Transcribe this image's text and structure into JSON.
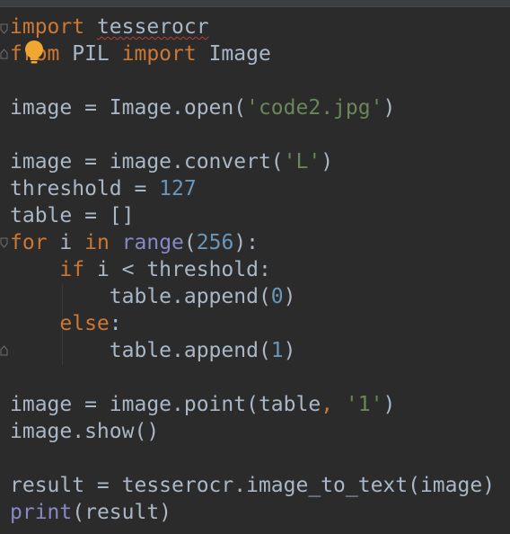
{
  "editor": {
    "lines": [
      [
        {
          "t": "import",
          "c": "kw"
        },
        {
          "t": " ",
          "c": "id"
        },
        {
          "t": "tesserocr",
          "c": "id typo"
        }
      ],
      [
        {
          "t": "from",
          "c": "kw"
        },
        {
          "t": " PIL ",
          "c": "id"
        },
        {
          "t": "import",
          "c": "kw"
        },
        {
          "t": " Image",
          "c": "id"
        }
      ],
      [],
      [
        {
          "t": "image = Image.open(",
          "c": "id"
        },
        {
          "t": "'code2.jpg'",
          "c": "str"
        },
        {
          "t": ")",
          "c": "id"
        }
      ],
      [],
      [
        {
          "t": "image = image.convert(",
          "c": "id"
        },
        {
          "t": "'L'",
          "c": "str"
        },
        {
          "t": ")",
          "c": "id"
        }
      ],
      [
        {
          "t": "threshold = ",
          "c": "id"
        },
        {
          "t": "127",
          "c": "num"
        }
      ],
      [
        {
          "t": "table = []",
          "c": "id"
        }
      ],
      [
        {
          "t": "for",
          "c": "kw"
        },
        {
          "t": " i ",
          "c": "id"
        },
        {
          "t": "in",
          "c": "kw"
        },
        {
          "t": " ",
          "c": "id"
        },
        {
          "t": "range",
          "c": "builtin"
        },
        {
          "t": "(",
          "c": "id"
        },
        {
          "t": "256",
          "c": "num"
        },
        {
          "t": "):",
          "c": "id"
        }
      ],
      [
        {
          "t": "    ",
          "c": "id"
        },
        {
          "t": "if",
          "c": "kw"
        },
        {
          "t": " i < threshold:",
          "c": "id"
        }
      ],
      [
        {
          "t": "        table.append(",
          "c": "id"
        },
        {
          "t": "0",
          "c": "num"
        },
        {
          "t": ")",
          "c": "id"
        }
      ],
      [
        {
          "t": "    ",
          "c": "id"
        },
        {
          "t": "else",
          "c": "kw"
        },
        {
          "t": ":",
          "c": "id"
        }
      ],
      [
        {
          "t": "        table.append(",
          "c": "id"
        },
        {
          "t": "1",
          "c": "num"
        },
        {
          "t": ")",
          "c": "id"
        }
      ],
      [],
      [
        {
          "t": "image = image.point(table",
          "c": "id"
        },
        {
          "t": ",",
          "c": "kw"
        },
        {
          "t": " ",
          "c": "id"
        },
        {
          "t": "'1'",
          "c": "str"
        },
        {
          "t": ")",
          "c": "id"
        }
      ],
      [
        {
          "t": "image.show()",
          "c": "id"
        }
      ],
      [],
      [
        {
          "t": "result = tesserocr.image_to_text(image)",
          "c": "id"
        }
      ],
      [
        {
          "t": "print",
          "c": "builtin"
        },
        {
          "t": "(result)",
          "c": "id"
        }
      ]
    ],
    "colors": {
      "background": "#2b2b2b",
      "keyword": "#cc7832",
      "identifier": "#a9b7c6",
      "string": "#6a8759",
      "number": "#6897bb",
      "builtin": "#8888c6",
      "intention_bulb": "#f0a732"
    },
    "intention_icon": "lightbulb-icon",
    "fold_icon": "fold-marker-icon"
  }
}
